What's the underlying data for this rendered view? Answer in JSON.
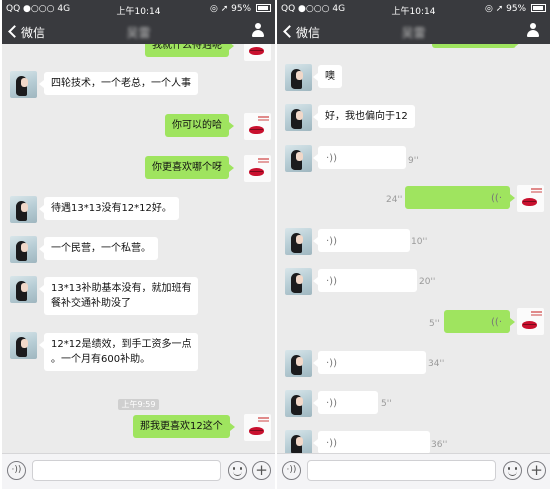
{
  "status_bar": {
    "carrier": "QQ",
    "network": "4G",
    "time": "上午10:14",
    "battery": "95%"
  },
  "nav": {
    "back_label": "微信",
    "contact_name": "吴雷"
  },
  "left": {
    "top_partial": "我就什么待遇呢",
    "messages": [
      "四轮技术，一个老总，一个人事",
      "你可以的哈",
      "你更喜欢哪个呀",
      "待遇13*13没有12*12好。",
      "一个民营，一个私营。",
      "13*13补助基本没有，就加班有",
      "餐补交通补助没了",
      "12*12是绩效，到手工资多一点",
      "。一个月有600补助。",
      "那我更喜欢12这个"
    ],
    "timestamp": "上午9:59"
  },
  "right": {
    "messages": [
      "噢",
      "好，我也偏向于12"
    ],
    "voice_durations": [
      "9''",
      "24''",
      "10''",
      "20''",
      "5''",
      "34''",
      "5''",
      "36''"
    ]
  },
  "icons": {
    "voice_wave": "·))",
    "voice_wave_right": "((·"
  }
}
